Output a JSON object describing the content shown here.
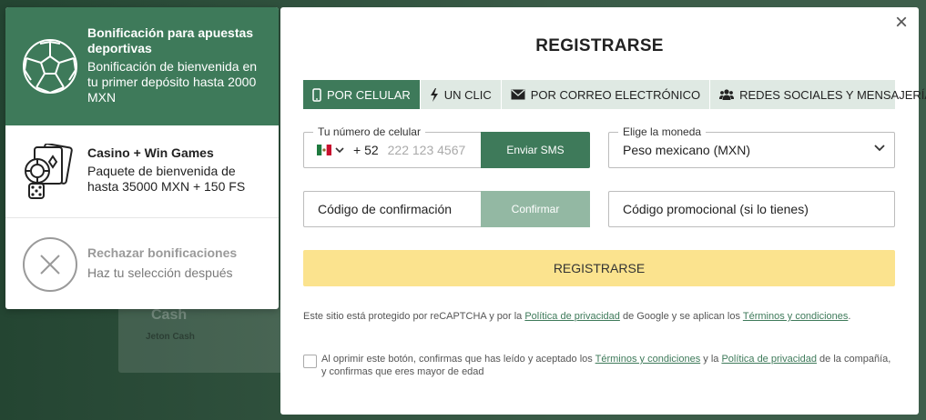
{
  "backdrop": {
    "card_title": "Cash",
    "card_sub": "Jeton Cash"
  },
  "bonuses": {
    "sports": {
      "title": "Bonificación para apuestas deportivas",
      "desc": "Bonificación de bienvenida en tu primer depósito hasta 2000 MXN",
      "icon": "soccer-ball-icon"
    },
    "casino": {
      "title": "Casino + Win Games",
      "desc": "Paquete de bienvenida de hasta 35000 MXN + 150 FS",
      "icon": "casino-chip-dice-icon"
    },
    "reject": {
      "title": "Rechazar bonificaciones",
      "desc": "Haz tu selección después",
      "icon": "cancel-circle-icon"
    }
  },
  "modal": {
    "title": "REGISTRARSE",
    "close_label": "×",
    "tabs": [
      {
        "label": "POR CELULAR",
        "icon": "mobile-phone-icon",
        "active": true
      },
      {
        "label": "UN CLIC",
        "icon": "lightning-icon",
        "active": false
      },
      {
        "label": "POR CORREO ELECTRÓNICO",
        "icon": "envelope-icon",
        "active": false
      },
      {
        "label": "REDES SOCIALES Y MENSAJERÍA",
        "icon": "users-icon",
        "active": false
      }
    ],
    "phone": {
      "label": "Tu número de celular",
      "prefix": "+ 52",
      "placeholder": "222 123 4567",
      "button": "Enviar SMS"
    },
    "currency": {
      "label": "Elige la moneda",
      "value": "Peso mexicano (MXN)"
    },
    "code": {
      "placeholder": "Código de confirmación",
      "button": "Confirmar"
    },
    "promo": {
      "placeholder": "Código promocional (si lo tienes)"
    },
    "register_button": "REGISTRARSE",
    "recaptcha": {
      "part1": "Este sitio está protegido por reCAPTCHA y por la ",
      "link1": "Política de privacidad",
      "part2": " de Google y se aplican los ",
      "link2": "Términos y condiciones",
      "part3": "."
    },
    "consent": {
      "part1": "Al oprimir este botón, confirmas que has leído y aceptado los ",
      "link1": "Términos y condiciones",
      "part2": " y la ",
      "link2": "Política de privacidad",
      "part3": " de la compañía, y confirmas que eres mayor de edad"
    }
  },
  "colors": {
    "accent": "#3e7a5a",
    "accent_light": "#93b8a3",
    "register": "#fbe38e",
    "tab_bg": "#dfe9e3"
  }
}
